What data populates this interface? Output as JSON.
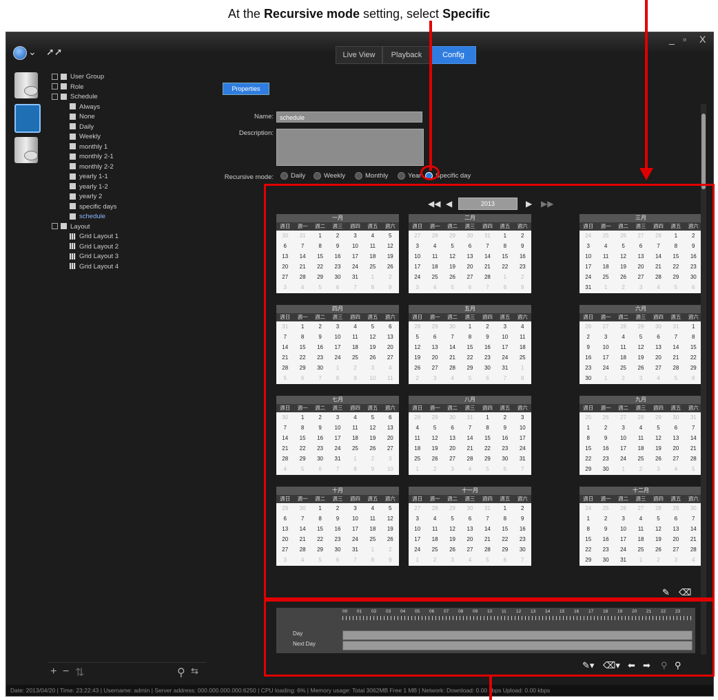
{
  "annotation": {
    "prefix": "At the ",
    "bold1": "Recursive mode",
    "mid": " setting, select ",
    "bold2": "Specific"
  },
  "titlebar": {
    "tabs": [
      {
        "label": "Live View",
        "active": false
      },
      {
        "label": "Playback",
        "active": false
      },
      {
        "label": "Config",
        "active": true
      }
    ],
    "window_controls": [
      "_",
      "▫",
      "X"
    ]
  },
  "tree": {
    "items": [
      {
        "label": "User Group",
        "level": 0,
        "expander": "+"
      },
      {
        "label": "Role",
        "level": 0,
        "expander": "+"
      },
      {
        "label": "Schedule",
        "level": 0,
        "expander": "−"
      },
      {
        "label": "Always",
        "level": 1
      },
      {
        "label": "None",
        "level": 1
      },
      {
        "label": "Daily",
        "level": 1
      },
      {
        "label": "Weekly",
        "level": 1
      },
      {
        "label": "monthly 1",
        "level": 1
      },
      {
        "label": "monthly 2-1",
        "level": 1
      },
      {
        "label": "monthly 2-2",
        "level": 1
      },
      {
        "label": "yearly 1-1",
        "level": 1
      },
      {
        "label": "yearly 1-2",
        "level": 1
      },
      {
        "label": "yearly 2",
        "level": 1
      },
      {
        "label": "specific days",
        "level": 1
      },
      {
        "label": "schedule",
        "level": 1,
        "selected": true
      },
      {
        "label": "Layout",
        "level": 0,
        "expander": "−"
      },
      {
        "label": "Grid Layout 1",
        "level": 1,
        "grid": true
      },
      {
        "label": "Grid Layout 2",
        "level": 1,
        "grid": true
      },
      {
        "label": "Grid Layout 3",
        "level": 1,
        "grid": true
      },
      {
        "label": "Grid Layout 4",
        "level": 1,
        "grid": true
      }
    ]
  },
  "properties": {
    "button_label": "Properties",
    "name_label": "Name:",
    "name_value": "schedule",
    "description_label": "Description:",
    "recursive_label": "Recursive mode:",
    "modes": [
      {
        "label": "Daily",
        "selected": false
      },
      {
        "label": "Weekly",
        "selected": false
      },
      {
        "label": "Monthly",
        "selected": false
      },
      {
        "label": "Year",
        "selected": false
      },
      {
        "label": "Specific day",
        "selected": true
      }
    ]
  },
  "calendar": {
    "year": "2013",
    "weekday_headers": [
      "週日",
      "週一",
      "週二",
      "週三",
      "週四",
      "週五",
      "週六"
    ],
    "months": [
      {
        "name": "一月",
        "first": 30,
        "prev_len": 31,
        "len": 31,
        "lead": 2
      },
      {
        "name": "二月",
        "first": 27,
        "prev_len": 31,
        "len": 28,
        "lead": 5
      },
      {
        "name": "三月",
        "first": 24,
        "prev_len": 28,
        "len": 31,
        "lead": 5
      },
      {
        "name": "四月",
        "first": 31,
        "prev_len": 31,
        "len": 30,
        "lead": 1
      },
      {
        "name": "五月",
        "first": 28,
        "prev_len": 30,
        "len": 31,
        "lead": 3
      },
      {
        "name": "六月",
        "first": 26,
        "prev_len": 31,
        "len": 30,
        "lead": 6
      },
      {
        "name": "七月",
        "first": 30,
        "prev_len": 30,
        "len": 31,
        "lead": 1
      },
      {
        "name": "八月",
        "first": 28,
        "prev_len": 31,
        "len": 31,
        "lead": 4
      },
      {
        "name": "九月",
        "first": 25,
        "prev_len": 31,
        "len": 30,
        "lead": 0
      },
      {
        "name": "十月",
        "first": 29,
        "prev_len": 30,
        "len": 31,
        "lead": 2
      },
      {
        "name": "十一月",
        "first": 27,
        "prev_len": 31,
        "len": 30,
        "lead": 5
      },
      {
        "name": "十二月",
        "first": 24,
        "prev_len": 30,
        "len": 31,
        "lead": 0
      }
    ]
  },
  "timeline": {
    "hours": [
      "00",
      "01",
      "02",
      "03",
      "04",
      "05",
      "06",
      "07",
      "08",
      "09",
      "10",
      "11",
      "12",
      "13",
      "14",
      "15",
      "16",
      "17",
      "18",
      "19",
      "20",
      "21",
      "22",
      "23"
    ],
    "rows": [
      "Day",
      "Next Day"
    ]
  },
  "status_bar": "Date: 2013/04/20 | Time: 23:22:43 | Username: admin | Server address: 000.000.000.000:6250 | CPU loading: 6% | Memory usage: Total 3062MB Free 1 MB | Network: Download: 0.00 kbps Upload: 0.00 kbps"
}
